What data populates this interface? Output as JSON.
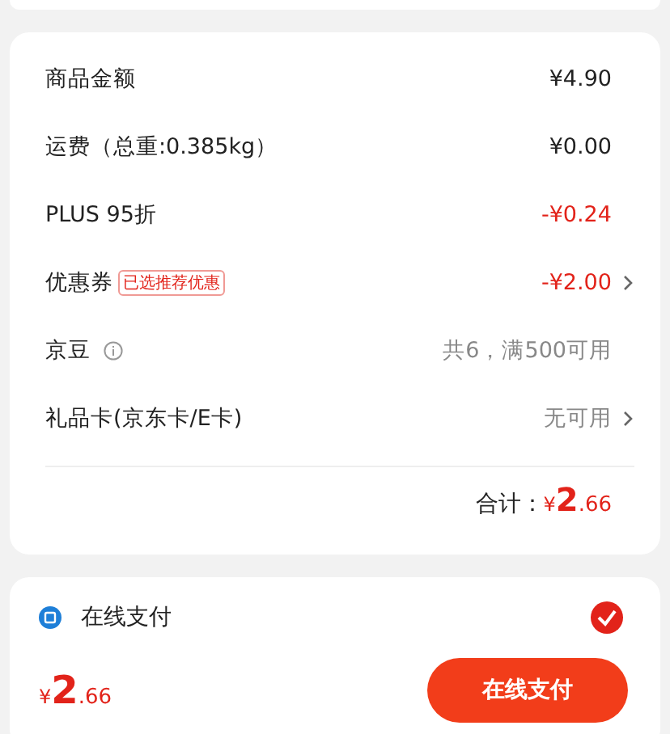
{
  "summary": {
    "rows": [
      {
        "label": "商品金额",
        "value": "¥4.90",
        "color": "#222222",
        "arrow": false
      },
      {
        "label": "运费（总重:0.385kg）",
        "value": "¥0.00",
        "color": "#222222",
        "arrow": false
      },
      {
        "label": "PLUS 95折",
        "value": "-¥0.24",
        "color": "#e2231a",
        "arrow": false
      },
      {
        "label": "优惠券",
        "tag": "已选推荐优惠",
        "value": "-¥2.00",
        "color": "#e2231a",
        "arrow": true
      },
      {
        "label": "京豆",
        "info": true,
        "value": "共6，满500可用",
        "color": "#888888",
        "arrow": false
      },
      {
        "label": "礼品卡(京东卡/E卡)",
        "value": "无可用",
        "color": "#888888",
        "arrow": true
      }
    ],
    "total": {
      "label": "合计：",
      "currency": "¥",
      "integer": "2",
      "decimal": ".66"
    }
  },
  "payment": {
    "method": "在线支付",
    "selected": true,
    "price": {
      "currency": "¥",
      "integer": "2",
      "decimal": ".66"
    },
    "button": "在线支付"
  }
}
